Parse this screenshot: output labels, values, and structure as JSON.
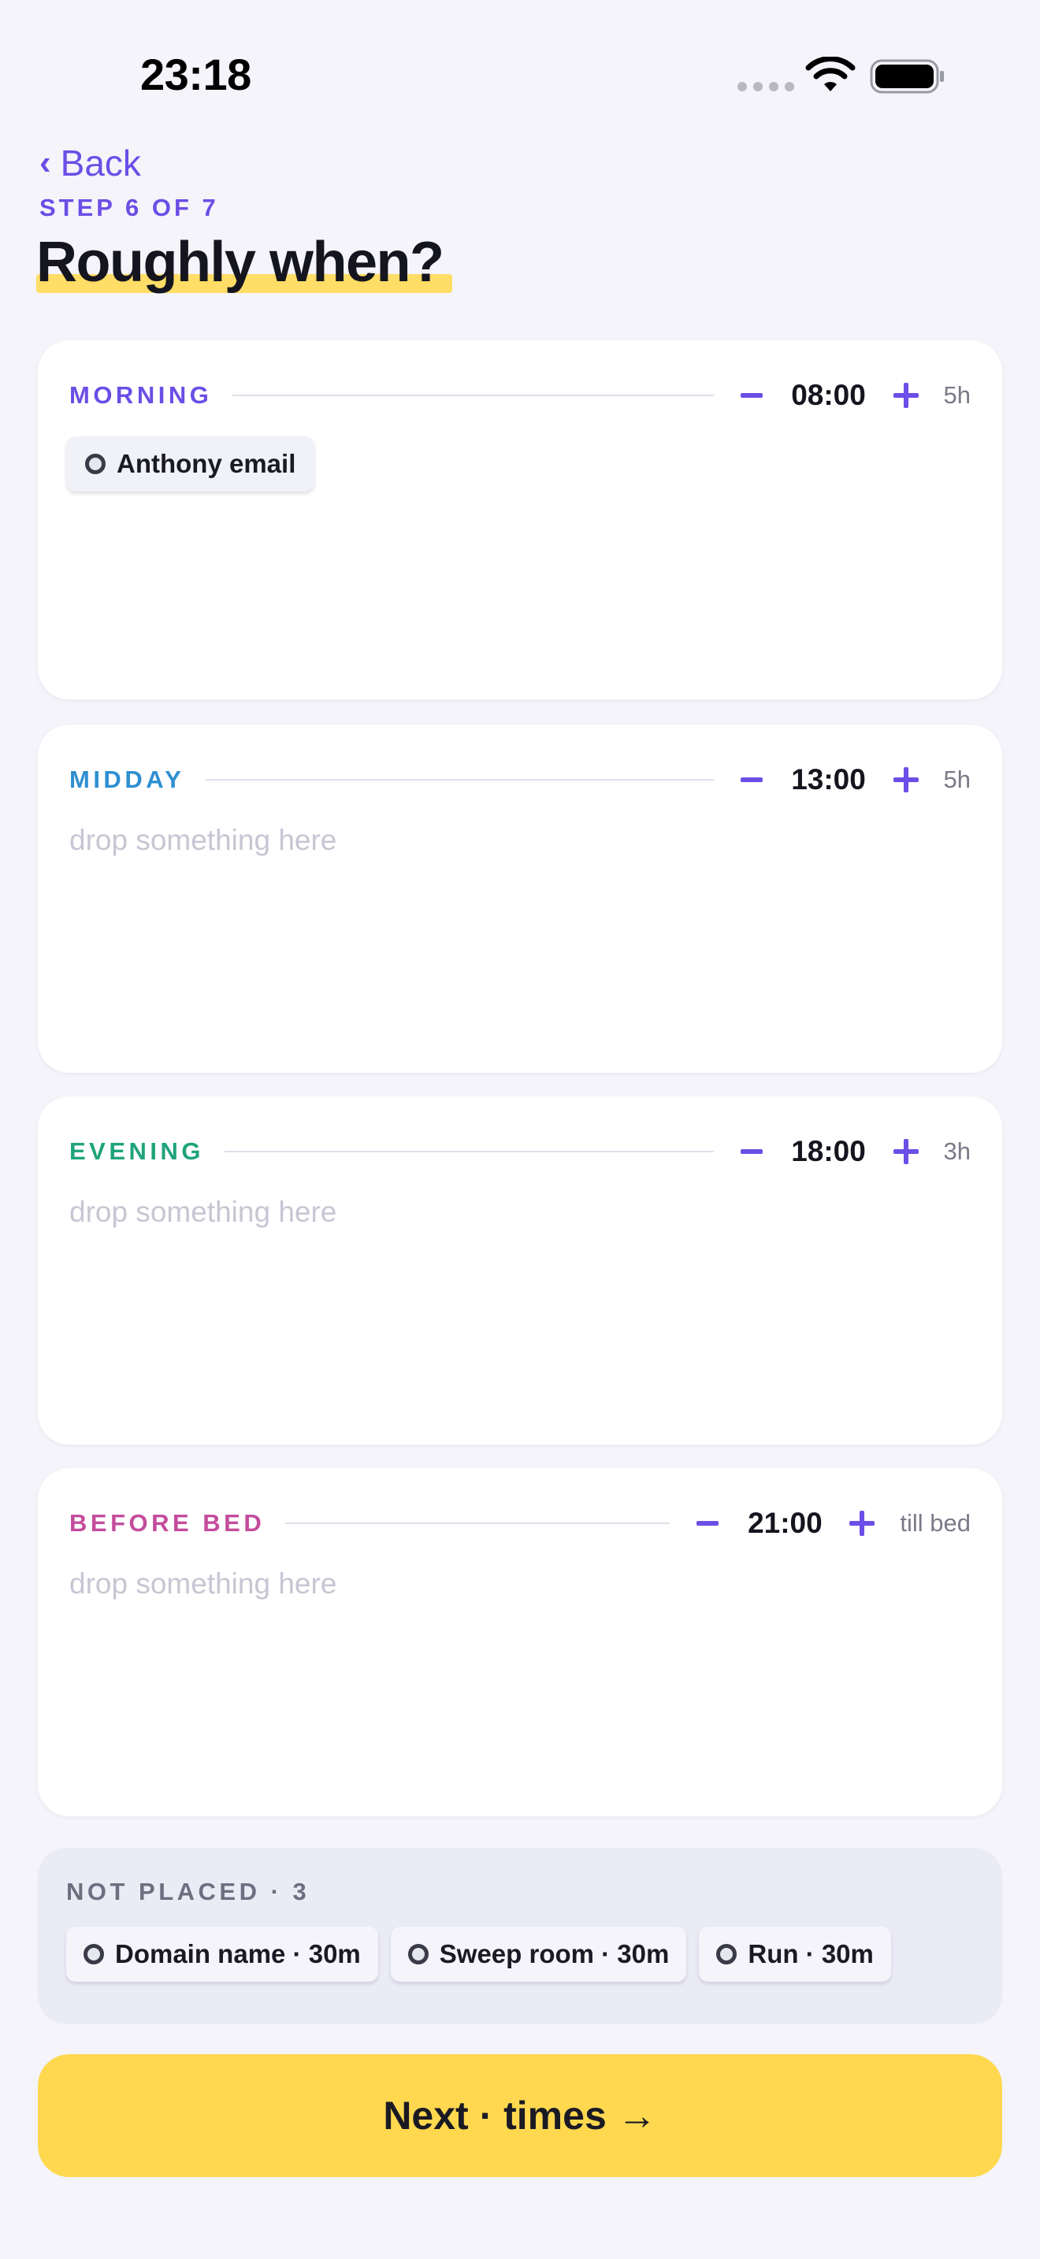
{
  "status_bar": {
    "time": "23:18"
  },
  "header": {
    "back_label": "Back",
    "step_label": "STEP 6 OF 7",
    "title": "Roughly when?"
  },
  "periods": [
    {
      "label": "MORNING",
      "color": "#6B4EE6",
      "time": "08:00",
      "duration": "5h",
      "tasks": [
        {
          "label": "Anthony email"
        }
      ],
      "placeholder": ""
    },
    {
      "label": "MIDDAY",
      "color": "#2E8FD0",
      "time": "13:00",
      "duration": "5h",
      "tasks": [],
      "placeholder": "drop something here"
    },
    {
      "label": "EVENING",
      "color": "#1FA37A",
      "time": "18:00",
      "duration": "3h",
      "tasks": [],
      "placeholder": "drop something here"
    },
    {
      "label": "BEFORE BED",
      "color": "#C44C9C",
      "time": "21:00",
      "duration": "till bed",
      "tasks": [],
      "placeholder": "drop something here"
    }
  ],
  "not_placed": {
    "title": "NOT PLACED · 3",
    "tasks": [
      {
        "label": "Domain name · 30m"
      },
      {
        "label": "Sweep room · 30m"
      },
      {
        "label": "Run · 30m"
      }
    ]
  },
  "next_button": {
    "label": "Next · times →"
  },
  "icons": {
    "back": "chevron-left-icon",
    "decrease": "minus-icon",
    "increase": "plus-icon",
    "task": "circle-icon",
    "wifi": "wifi-icon",
    "battery": "battery-icon",
    "signal": "signal-icon"
  },
  "colors": {
    "accent": "#6B4EE6",
    "background": "#F4F4FA",
    "title_highlight": "#FFDD66",
    "next_button": "#FFD84F"
  }
}
